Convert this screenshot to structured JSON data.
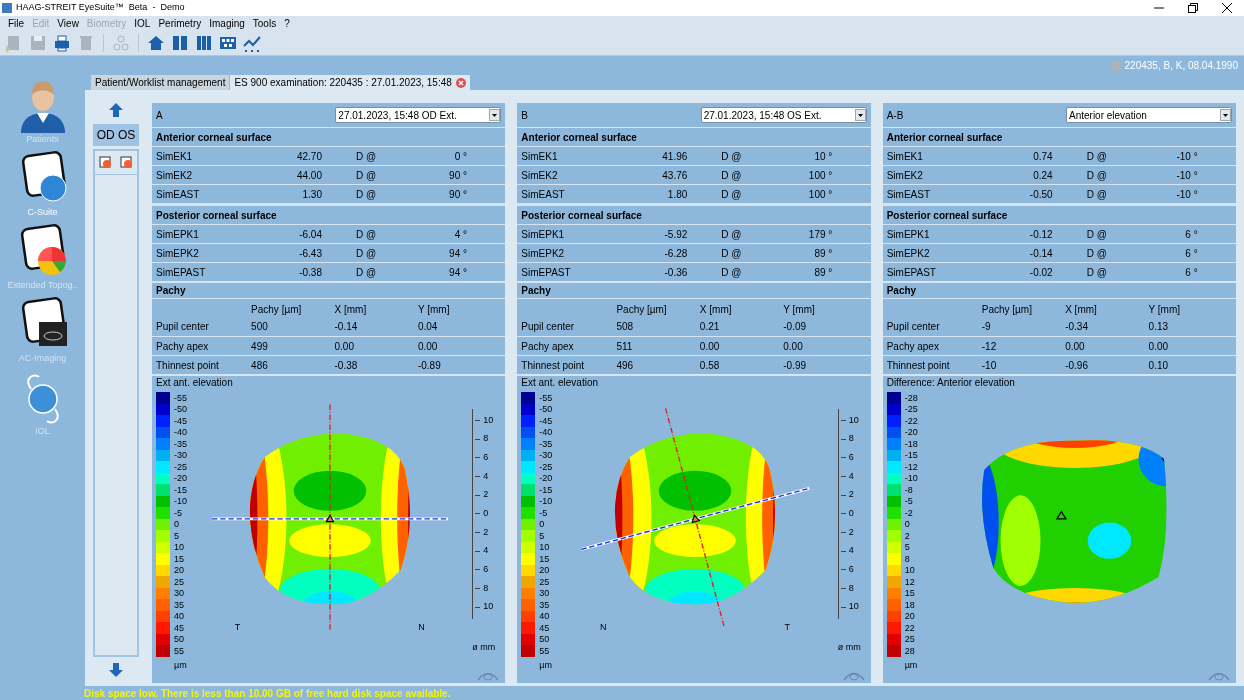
{
  "window": {
    "title": "HAAG-STREIT EyeSuite™  Beta  -  Demo"
  },
  "menu": [
    {
      "label": "File",
      "disabled": false
    },
    {
      "label": "Edit",
      "disabled": true
    },
    {
      "label": "View",
      "disabled": false
    },
    {
      "label": "Biometry",
      "disabled": true
    },
    {
      "label": "IOL",
      "disabled": false
    },
    {
      "label": "Perimetry",
      "disabled": false
    },
    {
      "label": "Imaging",
      "disabled": false
    },
    {
      "label": "Tools",
      "disabled": false
    },
    {
      "label": "?",
      "disabled": false
    }
  ],
  "toolbar": [
    {
      "disabled": true
    },
    {
      "disabled": true
    },
    {
      "disabled": false
    },
    {
      "disabled": true
    },
    {
      "disabled": true
    },
    {
      "disabled": false
    },
    {
      "disabled": false
    },
    {
      "disabled": false
    },
    {
      "disabled": false
    },
    {
      "disabled": false
    }
  ],
  "patient": "220435, B, K, 08.04.1990",
  "tabs": [
    {
      "label": "Patient/Worklist management",
      "selected": false
    },
    {
      "label": "ES 900 examination: 220435 : 27.01.2023, 15:48",
      "selected": true
    }
  ],
  "sidebar": {
    "items": [
      {
        "label": "Patients",
        "selected": false
      },
      {
        "label": "C-Suite",
        "selected": true
      },
      {
        "label": "Extended Topog..",
        "selected": false
      },
      {
        "label": "AC-Imaging",
        "selected": false
      },
      {
        "label": "IOL",
        "selected": false
      }
    ]
  },
  "eye_column": {
    "header": "OD OS"
  },
  "panels": [
    {
      "label": "A",
      "select": "27.01.2023, 15:48 OD Ext.",
      "kind": "exam",
      "sections": [
        {
          "title": "Anterior corneal surface",
          "rows": [
            [
              "SimEK1",
              "42.70",
              "D @",
              "0 °"
            ],
            [
              "SimEK2",
              "44.00",
              "D @",
              "90 °"
            ],
            [
              "SimEAST",
              "1.30",
              "D @",
              "90 °"
            ]
          ]
        },
        {
          "title": "Posterior corneal surface",
          "rows": [
            [
              "SimEPK1",
              "-6.04",
              "D @",
              "4 °"
            ],
            [
              "SimEPK2",
              "-6.43",
              "D @",
              "94 °"
            ],
            [
              "SimEPAST",
              "-0.38",
              "D @",
              "94 °"
            ]
          ]
        }
      ],
      "pachy": {
        "title": "Pachy",
        "columns": [
          "",
          "Pachy [µm]",
          "X [mm]",
          "Y [mm]"
        ],
        "rows": [
          [
            "Pupil center",
            "500",
            "-0.14",
            "0.04"
          ],
          [
            "Pachy apex",
            "499",
            "0.00",
            "0.00"
          ],
          [
            "Thinnest point",
            "486",
            "-0.38",
            "-0.89"
          ]
        ]
      },
      "map": {
        "title": "Ext ant. elevation",
        "legend": [
          "-55",
          "-50",
          "-45",
          "-40",
          "-35",
          "-30",
          "-25",
          "-20",
          "-15",
          "-10",
          "-5",
          "0",
          "5",
          "10",
          "15",
          "20",
          "25",
          "30",
          "35",
          "40",
          "45",
          "50",
          "55"
        ],
        "unit": "µm",
        "scale": [
          "10",
          "8",
          "6",
          "4",
          "2",
          "0",
          "2",
          "4",
          "6",
          "8",
          "10"
        ],
        "sides": [
          "T",
          "N"
        ],
        "scale_unit": "ø mm"
      }
    },
    {
      "label": "B",
      "select": "27.01.2023, 15:48 OS Ext.",
      "kind": "exam",
      "sections": [
        {
          "title": "Anterior corneal surface",
          "rows": [
            [
              "SimEK1",
              "41.96",
              "D @",
              "10 °"
            ],
            [
              "SimEK2",
              "43.76",
              "D @",
              "100 °"
            ],
            [
              "SimEAST",
              "1.80",
              "D @",
              "100 °"
            ]
          ]
        },
        {
          "title": "Posterior corneal surface",
          "rows": [
            [
              "SimEPK1",
              "-5.92",
              "D @",
              "179 °"
            ],
            [
              "SimEPK2",
              "-6.28",
              "D @",
              "89 °"
            ],
            [
              "SimEPAST",
              "-0.36",
              "D @",
              "89 °"
            ]
          ]
        }
      ],
      "pachy": {
        "title": "Pachy",
        "columns": [
          "",
          "Pachy [µm]",
          "X [mm]",
          "Y [mm]"
        ],
        "rows": [
          [
            "Pupil center",
            "508",
            "0.21",
            "-0.09"
          ],
          [
            "Pachy apex",
            "511",
            "0.00",
            "0.00"
          ],
          [
            "Thinnest point",
            "496",
            "0.58",
            "-0.99"
          ]
        ]
      },
      "map": {
        "title": "Ext ant. elevation",
        "legend": [
          "-55",
          "-50",
          "-45",
          "-40",
          "-35",
          "-30",
          "-25",
          "-20",
          "-15",
          "-10",
          "-5",
          "0",
          "5",
          "10",
          "15",
          "20",
          "25",
          "30",
          "35",
          "40",
          "45",
          "50",
          "55"
        ],
        "unit": "µm",
        "scale": [
          "10",
          "8",
          "6",
          "4",
          "2",
          "0",
          "2",
          "4",
          "6",
          "8",
          "10"
        ],
        "sides": [
          "N",
          "T"
        ],
        "scale_unit": "ø mm"
      }
    },
    {
      "label": "A-B",
      "select": "Anterior elevation",
      "kind": "difference",
      "sections": [
        {
          "title": "Anterior corneal surface",
          "rows": [
            [
              "SimEK1",
              "0.74",
              "D @",
              "-10 °"
            ],
            [
              "SimEK2",
              "0.24",
              "D @",
              "-10 °"
            ],
            [
              "SimEAST",
              "-0.50",
              "D @",
              "-10 °"
            ]
          ]
        },
        {
          "title": "Posterior corneal surface",
          "rows": [
            [
              "SimEPK1",
              "-0.12",
              "D @",
              "6 °"
            ],
            [
              "SimEPK2",
              "-0.14",
              "D @",
              "6 °"
            ],
            [
              "SimEPAST",
              "-0.02",
              "D @",
              "6 °"
            ]
          ]
        }
      ],
      "pachy": {
        "title": "Pachy",
        "columns": [
          "",
          "Pachy [µm]",
          "X [mm]",
          "Y [mm]"
        ],
        "rows": [
          [
            "Pupil center",
            "-9",
            "-0.34",
            "0.13"
          ],
          [
            "Pachy apex",
            "-12",
            "0.00",
            "0.00"
          ],
          [
            "Thinnest point",
            "-10",
            "-0.96",
            "0.10"
          ]
        ]
      },
      "map": {
        "title": "Difference: Anterior elevation",
        "legend": [
          "-28",
          "-25",
          "-22",
          "-20",
          "-18",
          "-15",
          "-12",
          "-10",
          "-8",
          "-5",
          "-2",
          "0",
          "2",
          "5",
          "8",
          "10",
          "12",
          "15",
          "18",
          "20",
          "22",
          "25",
          "28"
        ],
        "unit": "µm"
      }
    }
  ],
  "status_bar": "Disk space low. There is less than 10.00 GB of free hard disk space available."
}
